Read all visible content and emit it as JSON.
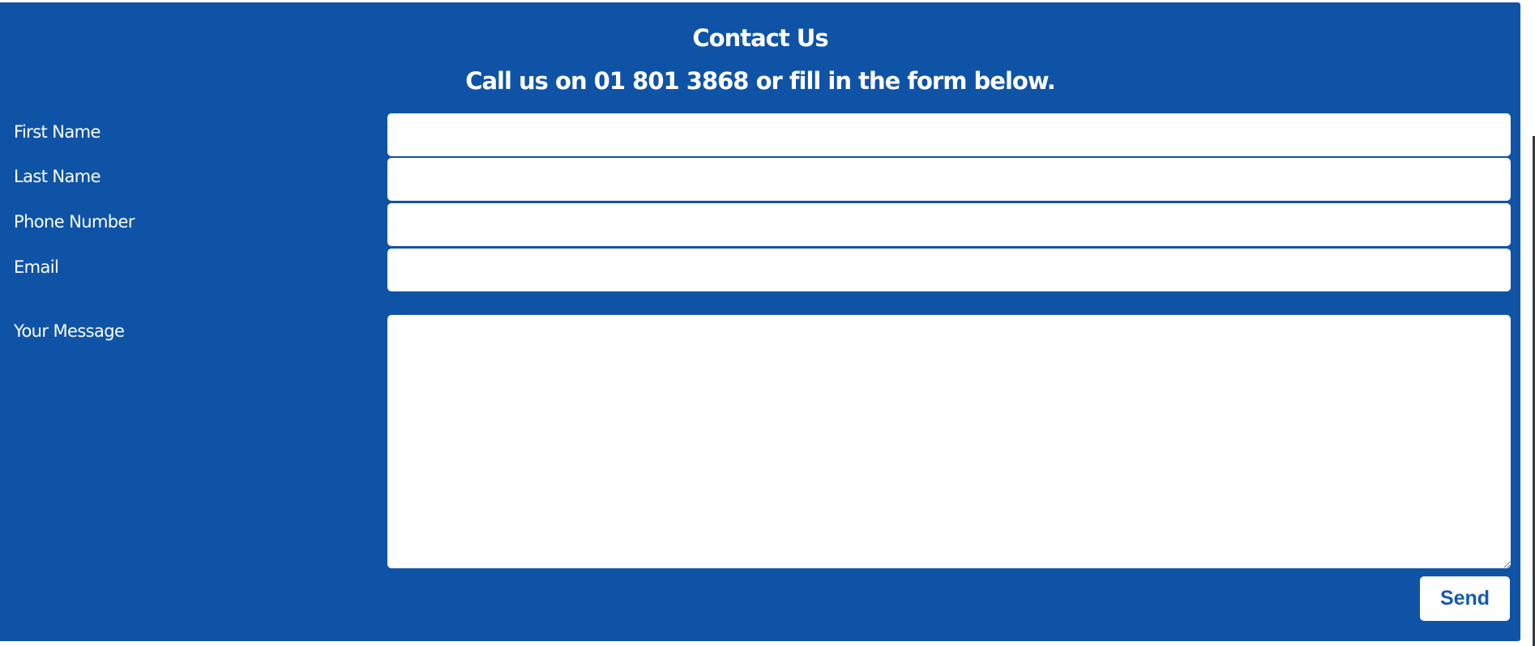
{
  "contact": {
    "title": "Contact Us",
    "subtitle": "Call us on 01 801 3868 or fill in the form below."
  },
  "form": {
    "first_name_label": "First Name",
    "last_name_label": "Last Name",
    "phone_label": "Phone Number",
    "email_label": "Email",
    "message_label": "Your Message",
    "send_label": "Send"
  },
  "colors": {
    "panel_background": "#0f53a7",
    "button_text": "#1559b0"
  }
}
